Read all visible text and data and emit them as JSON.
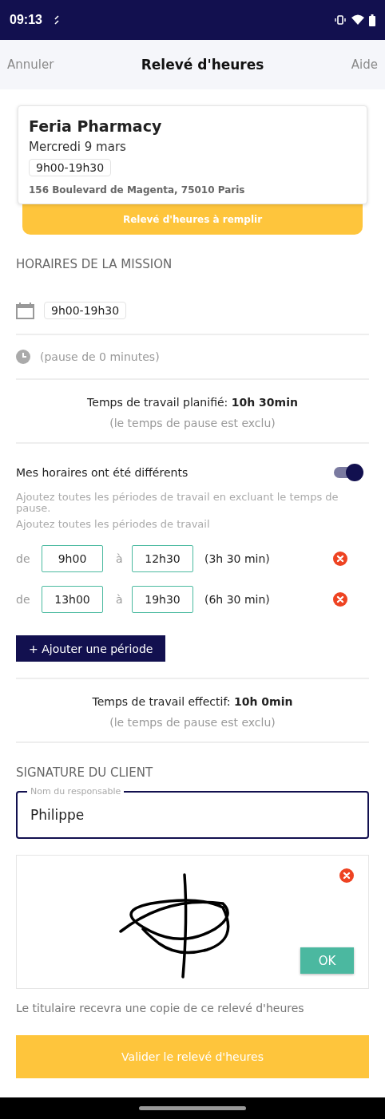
{
  "status_bar": {
    "time": "09:13"
  },
  "nav": {
    "cancel": "Annuler",
    "title": "Relevé d'heures",
    "help": "Aide"
  },
  "mission_card": {
    "name": "Feria Pharmacy",
    "date": "Mercredi 9 mars",
    "hours": "9h00-19h30",
    "address": "156 Boulevard de Magenta, 75010 Paris",
    "banner": "Relevé d'heures à remplir"
  },
  "mission_schedule": {
    "heading": "HORAIRES DE LA MISSION",
    "hours": "9h00-19h30",
    "pause": "(pause de 0 minutes)",
    "planned_label": "Temps de travail planifié: ",
    "planned_value": "10h 30min",
    "planned_note": "(le temps de pause est exclu)"
  },
  "different_hours": {
    "label": "Mes horaires ont été différents",
    "on": true,
    "hint": "Ajoutez toutes les périodes de travail en excluant le temps de pause.",
    "hint2": "Ajoutez toutes les périodes de travail"
  },
  "periods": [
    {
      "from_label": "de",
      "from": "9h00",
      "to_label": "à",
      "to": "12h30",
      "duration": "(3h 30 min)"
    },
    {
      "from_label": "de",
      "from": "13h00",
      "to_label": "à",
      "to": "19h30",
      "duration": "(6h 30 min)"
    }
  ],
  "add_period": "+ Ajouter une période",
  "effective": {
    "label": "Temps de travail effectif: ",
    "value": "10h 0min",
    "note": "(le temps de pause est exclu)"
  },
  "signature": {
    "heading": "SIGNATURE DU CLIENT",
    "name_label": "Nom du responsable",
    "name_value": "Philippe",
    "ok": "OK",
    "note": "Le titulaire recevra une copie de ce relevé d'heures"
  },
  "submit": "Valider le relevé d'heures"
}
